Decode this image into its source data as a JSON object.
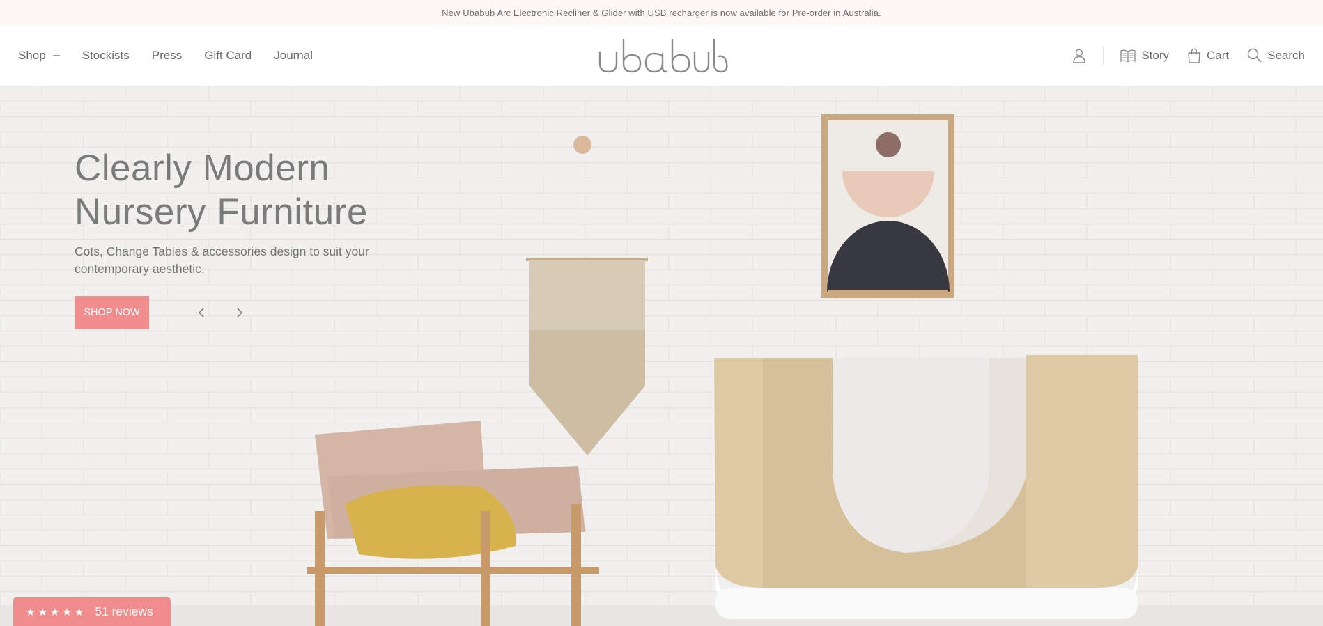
{
  "announcement": "New Ubabub Arc Electronic Recliner & Glider with USB recharger is now available for Pre-order in Australia.",
  "nav": {
    "shop": "Shop",
    "stockists": "Stockists",
    "press": "Press",
    "gift_card": "Gift Card",
    "journal": "Journal"
  },
  "logo_text": "ubabub",
  "right_nav": {
    "story": "Story",
    "cart": "Cart",
    "search": "Search"
  },
  "hero": {
    "title_line1": "Clearly Modern",
    "title_line2": "Nursery Furniture",
    "subtitle": "Cots, Change Tables & accessories design to suit your contemporary aesthetic.",
    "cta": "SHOP NOW"
  },
  "reviews": {
    "stars": "★★★★★",
    "label": "51 reviews"
  },
  "colors": {
    "accent": "#f08c8c",
    "announce_bg": "#fdf8f6",
    "hero_bg": "#f0efed"
  }
}
